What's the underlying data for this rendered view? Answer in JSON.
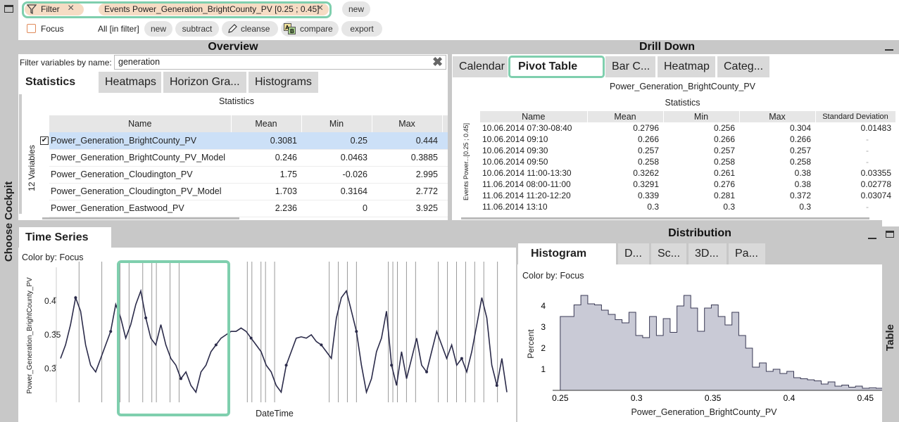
{
  "topbar": {
    "filter_label": "Filter",
    "filter_chip": "Events Power_Generation_BrightCounty_PV [0.25 ; 0.45]",
    "new_label": "new",
    "focus_label": "Focus",
    "focus_scope": "All [in filter]",
    "focus_new": "new",
    "subtract": "subtract",
    "cleanse": "cleanse",
    "compare": "compare",
    "export": "export"
  },
  "sidebar_left": {
    "label": "Choose Cockpit"
  },
  "sidebar_right": {
    "label": "Table"
  },
  "overview": {
    "title": "Overview",
    "filter_label": "Filter variables by name:",
    "filter_value": "generation",
    "tabs": [
      "Statistics",
      "Heatmaps",
      "Horizon Gra...",
      "Histograms"
    ],
    "subtitle": "Statistics",
    "variables_count": "12 Variables",
    "columns": [
      "Name",
      "Mean",
      "Min",
      "Max"
    ],
    "rows": [
      {
        "name": "Power_Generation_BrightCounty_PV",
        "mean": "0.3081",
        "min": "0.25",
        "max": "0.444",
        "checked": true
      },
      {
        "name": "Power_Generation_BrightCounty_PV_Model",
        "mean": "0.246",
        "min": "0.0463",
        "max": "0.3885"
      },
      {
        "name": "Power_Generation_Cloudington_PV",
        "mean": "1.75",
        "min": "-0.026",
        "max": "2.995"
      },
      {
        "name": "Power_Generation_Cloudington_PV_Model",
        "mean": "1.703",
        "min": "0.3164",
        "max": "2.772"
      },
      {
        "name": "Power_Generation_Eastwood_PV",
        "mean": "2.236",
        "min": "0",
        "max": "3.925"
      }
    ]
  },
  "drilldown": {
    "title": "Drill Down",
    "tabs": [
      "Calendar",
      "Pivot Table",
      "Bar C...",
      "Heatmap",
      "Categ..."
    ],
    "chart_title": "Power_Generation_BrightCounty_PV",
    "subtitle": "Statistics",
    "side_label": "Events Power...[0.25 ; 0.45]",
    "columns": [
      "Name",
      "Mean",
      "Min",
      "Max",
      "Standard Deviation"
    ],
    "rows": [
      [
        "10.06.2014 07:30-08:40",
        "0.2796",
        "0.256",
        "0.304",
        "0.01483"
      ],
      [
        "10.06.2014 09:10",
        "0.266",
        "0.266",
        "0.266",
        "-"
      ],
      [
        "10.06.2014 09:30",
        "0.257",
        "0.257",
        "0.257",
        "-"
      ],
      [
        "10.06.2014 09:50",
        "0.258",
        "0.258",
        "0.258",
        "-"
      ],
      [
        "10.06.2014 11:00-13:30",
        "0.3262",
        "0.261",
        "0.38",
        "0.03355"
      ],
      [
        "11.06.2014 08:00-11:00",
        "0.3291",
        "0.276",
        "0.38",
        "0.02778"
      ],
      [
        "11.06.2014 11:20-12:20",
        "0.339",
        "0.281",
        "0.372",
        "0.03074"
      ],
      [
        "11.06.2014 13:10",
        "0.3",
        "0.3",
        "0.3",
        "-"
      ]
    ]
  },
  "timeseries": {
    "title": "Time Series",
    "color_by": "Color by: Focus",
    "ylabel": "Power_Generation_BrightCounty_PV",
    "xlabel": "DateTime",
    "yticks": [
      "0.4",
      "0.35",
      "0.3"
    ]
  },
  "distribution": {
    "title": "Distribution",
    "tabs": [
      "Histogram",
      "D...",
      "Sc...",
      "3D...",
      "Pa..."
    ],
    "color_by": "Color by: Focus",
    "ylabel": "Percent",
    "xlabel": "Power_Generation_BrightCounty_PV"
  },
  "chart_data": [
    {
      "type": "line",
      "title": "",
      "xlabel": "DateTime",
      "ylabel": "Power_Generation_BrightCounty_PV",
      "ylim": [
        0.245,
        0.445
      ],
      "y_ticks": [
        0.3,
        0.35,
        0.4
      ],
      "series": [
        {
          "values": [
            0.31,
            0.33,
            0.36,
            0.4,
            0.38,
            0.33,
            0.3,
            0.29,
            0.31,
            0.33,
            0.35,
            0.39,
            0.37,
            0.34,
            0.36,
            0.39,
            0.41,
            0.37,
            0.34,
            0.33,
            0.36,
            0.33,
            0.31,
            0.3,
            0.28,
            0.29,
            0.27,
            0.26,
            0.29,
            0.3,
            0.32,
            0.33,
            0.34,
            0.345,
            0.35,
            0.35,
            0.355,
            0.35,
            0.34,
            0.33,
            0.32,
            0.3,
            0.29,
            0.27,
            0.26,
            0.3,
            0.32,
            0.34,
            0.342,
            0.34,
            0.345,
            0.335,
            0.33,
            0.32,
            0.31,
            0.37,
            0.4,
            0.41,
            0.38,
            0.35,
            0.3,
            0.26,
            0.28,
            0.32,
            0.34,
            0.38,
            0.3,
            0.27,
            0.32,
            0.28,
            0.31,
            0.34,
            0.3,
            0.29,
            0.32,
            0.35,
            0.33,
            0.31,
            0.33,
            0.3,
            0.31,
            0.29,
            0.32,
            0.36,
            0.4,
            0.37,
            0.3,
            0.27,
            0.31,
            0.26
          ]
        }
      ]
    },
    {
      "type": "area",
      "title": "",
      "xlabel": "Power_Generation_BrightCounty_PV",
      "ylabel": "Percent",
      "xlim": [
        0.245,
        0.46
      ],
      "ylim": [
        0,
        4.9
      ],
      "x_ticks": [
        0.25,
        0.3,
        0.35,
        0.4,
        0.45
      ],
      "y_ticks": [
        1,
        2,
        3,
        4
      ],
      "bin_start": 0.25,
      "bin_width": 0.0045,
      "values": [
        3.5,
        3.5,
        4.05,
        4.5,
        4.1,
        4.05,
        3.8,
        3.6,
        3.35,
        3.2,
        3.7,
        2.6,
        2.5,
        3.5,
        2.6,
        3.4,
        2.75,
        4.0,
        4.5,
        3.9,
        2.8,
        3.9,
        4.05,
        3.5,
        3.1,
        3.7,
        2.6,
        2.0,
        1.1,
        1.3,
        0.9,
        1.0,
        0.8,
        0.9,
        0.6,
        0.55,
        0.5,
        0.45,
        0.3,
        0.4,
        0.2,
        0.25,
        0.15,
        0.2,
        0.1,
        0.12,
        0.1,
        0.05
      ]
    }
  ]
}
